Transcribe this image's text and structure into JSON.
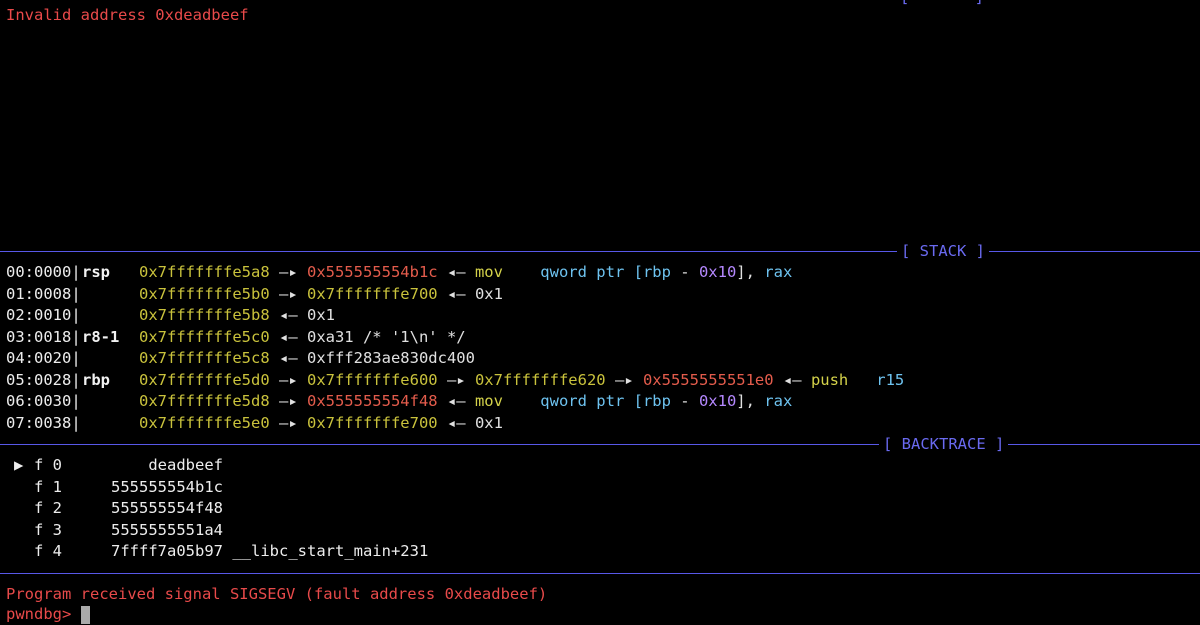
{
  "error_line": "Invalid address 0xdeadbeef",
  "top_stub": "[ ─ ─ ─ ]",
  "sections": {
    "stack_label": "[ STACK ]",
    "backtrace_label": "[ BACKTRACE ]"
  },
  "stack": [
    {
      "idx": "00:0000|",
      "reg": "rsp",
      "addr": "0x7fffffffe5a8",
      "arrow1": " —▸ ",
      "val1": "0x555555554b1c",
      "arrow2": " ◂— ",
      "insn": "mov",
      "ops": [
        "qword ptr [",
        "rbp",
        " - ",
        "0x10",
        "], ",
        "rax"
      ]
    },
    {
      "idx": "01:0008|",
      "reg": "",
      "addr": "0x7fffffffe5b0",
      "arrow1": " —▸ ",
      "val1": "0x7fffffffe700",
      "arrow2": " ◂— ",
      "tail": "0x1"
    },
    {
      "idx": "02:0010|",
      "reg": "",
      "addr": "0x7fffffffe5b8",
      "arrow1": " ◂— ",
      "tail": "0x1"
    },
    {
      "idx": "03:0018|",
      "reg": "r8-1",
      "addr": "0x7fffffffe5c0",
      "arrow1": " ◂— ",
      "tail": "0xa31 /* '1\\n' */"
    },
    {
      "idx": "04:0020|",
      "reg": "",
      "addr": "0x7fffffffe5c8",
      "arrow1": " ◂— ",
      "tail": "0xfff283ae830dc400"
    },
    {
      "idx": "05:0028|",
      "reg": "rbp",
      "addr": "0x7fffffffe5d0",
      "arrow1": " —▸ ",
      "val1": "0x7fffffffe600",
      "arrow2": " —▸ ",
      "val2": "0x7fffffffe620",
      "arrow3": " —▸ ",
      "val3": "0x5555555551e0",
      "arrow4": " ◂— ",
      "insn": "push",
      "reg_op": "r15"
    },
    {
      "idx": "06:0030|",
      "reg": "",
      "addr": "0x7fffffffe5d8",
      "arrow1": " —▸ ",
      "val1": "0x555555554f48",
      "arrow2": " ◂— ",
      "insn": "mov",
      "ops": [
        "qword ptr [",
        "rbp",
        " - ",
        "0x10",
        "], ",
        "rax"
      ]
    },
    {
      "idx": "07:0038|",
      "reg": "",
      "addr": "0x7fffffffe5e0",
      "arrow1": " —▸ ",
      "val1": "0x7fffffffe700",
      "arrow2": " ◂— ",
      "tail": "0x1"
    }
  ],
  "backtrace": [
    {
      "marker": "▶",
      "frame": "f 0",
      "addr": "deadbeef",
      "sym": ""
    },
    {
      "marker": "",
      "frame": "f 1",
      "addr": "555555554b1c",
      "sym": ""
    },
    {
      "marker": "",
      "frame": "f 2",
      "addr": "555555554f48",
      "sym": ""
    },
    {
      "marker": "",
      "frame": "f 3",
      "addr": "5555555551a4",
      "sym": ""
    },
    {
      "marker": "",
      "frame": "f 4",
      "addr": "7ffff7a05b97",
      "sym": "__libc_start_main+231"
    }
  ],
  "signal_line": "Program received signal SIGSEGV (fault address 0xdeadbeef)",
  "prompt": "pwndbg> "
}
